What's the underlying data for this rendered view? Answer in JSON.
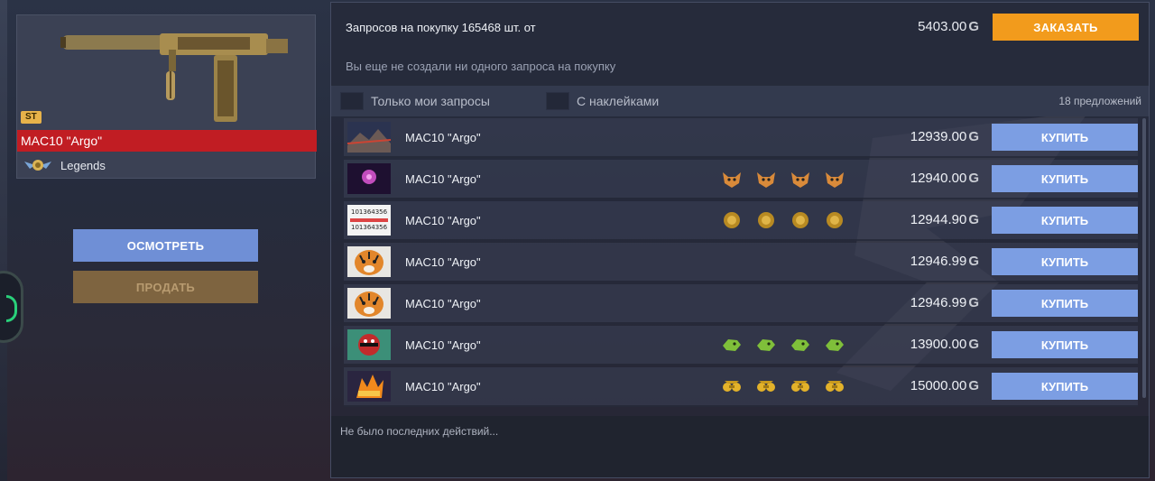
{
  "item": {
    "badge": "ST",
    "name": "MAC10 \"Argo\"",
    "rarity": "Legends",
    "rarity_icon": "legends-wings-icon"
  },
  "actions": {
    "inspect_label": "ОСМОТРЕТЬ",
    "sell_label": "ПРОДАТЬ"
  },
  "buy_orders": {
    "summary": "Запросов на покупку 165468 шт. от",
    "min_price": "5403.00",
    "currency_symbol": "G",
    "order_label": "ЗАКАЗАТЬ",
    "empty_message": "Вы еще не создали ни одного запроса на покупку"
  },
  "filters": {
    "only_mine": "Только мои запросы",
    "with_stickers": "С наклейками",
    "offers_count": "18 предложений"
  },
  "listings": [
    {
      "name": "MAC10 \"Argo\"",
      "price": "12939.00",
      "thumb": "mountain-thumb",
      "stickers": [],
      "buy_label": "КУПИТЬ"
    },
    {
      "name": "MAC10 \"Argo\"",
      "price": "12940.00",
      "thumb": "pink-flower-thumb",
      "stickers": [
        "fox-sticker",
        "fox-sticker",
        "fox-sticker",
        "fox-sticker"
      ],
      "buy_label": "КУПИТЬ"
    },
    {
      "name": "MAC10 \"Argo\"",
      "price": "12944.90",
      "thumb": "text-note-thumb",
      "thumb_text": [
        "101364356",
        "101364356"
      ],
      "stickers": [
        "gold-lion-sticker",
        "gold-lion-sticker",
        "gold-lion-sticker",
        "gold-lion-sticker"
      ],
      "buy_label": "КУПИТЬ"
    },
    {
      "name": "MAC10 \"Argo\"",
      "price": "12946.99",
      "thumb": "tiger-thumb",
      "stickers": [],
      "buy_label": "КУПИТЬ"
    },
    {
      "name": "MAC10 \"Argo\"",
      "price": "12946.99",
      "thumb": "tiger-thumb",
      "stickers": [],
      "buy_label": "КУПИТЬ"
    },
    {
      "name": "MAC10 \"Argo\"",
      "price": "13900.00",
      "thumb": "ball-face-thumb",
      "stickers": [
        "green-dragon-sticker",
        "green-dragon-sticker",
        "green-dragon-sticker",
        "green-dragon-sticker"
      ],
      "buy_label": "КУПИТЬ"
    },
    {
      "name": "MAC10 \"Argo\"",
      "price": "15000.00",
      "thumb": "fire-logo-thumb",
      "stickers": [
        "gold-goggles-sticker",
        "gold-goggles-sticker",
        "gold-goggles-sticker",
        "gold-goggles-sticker"
      ],
      "buy_label": "КУПИТЬ"
    }
  ],
  "activity": {
    "message": "Не было последних действий..."
  },
  "colors": {
    "order_button": "#f29b1c",
    "buy_button": "#7c9ee3",
    "inspect_button": "#6f8fd6",
    "sell_button": "#7e6440",
    "rarity_bar": "#c11d23"
  }
}
